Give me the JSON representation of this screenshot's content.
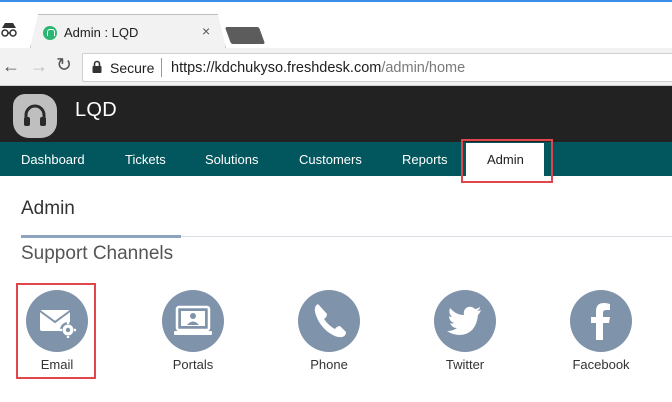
{
  "browser": {
    "tab_title": "Admin : LQD",
    "tab_close": "×",
    "security_label": "Secure",
    "url_host": "https://kdchukyso.freshdesk.com",
    "url_path": "/admin/home"
  },
  "app": {
    "brand": "LQD"
  },
  "nav": {
    "items": [
      "Dashboard",
      "Tickets",
      "Solutions",
      "Customers",
      "Reports",
      "Admin"
    ],
    "active": "Admin"
  },
  "page": {
    "title": "Admin",
    "section_title": "Support Channels"
  },
  "channels": [
    {
      "label": "Email",
      "icon": "email-gear-icon"
    },
    {
      "label": "Portals",
      "icon": "portal-icon"
    },
    {
      "label": "Phone",
      "icon": "phone-icon"
    },
    {
      "label": "Twitter",
      "icon": "twitter-icon"
    },
    {
      "label": "Facebook",
      "icon": "facebook-icon"
    }
  ],
  "colors": {
    "nav_bg": "#02575e",
    "header_bg": "#222222",
    "icon_circle": "#7f93aa",
    "highlight": "#e0474c"
  }
}
